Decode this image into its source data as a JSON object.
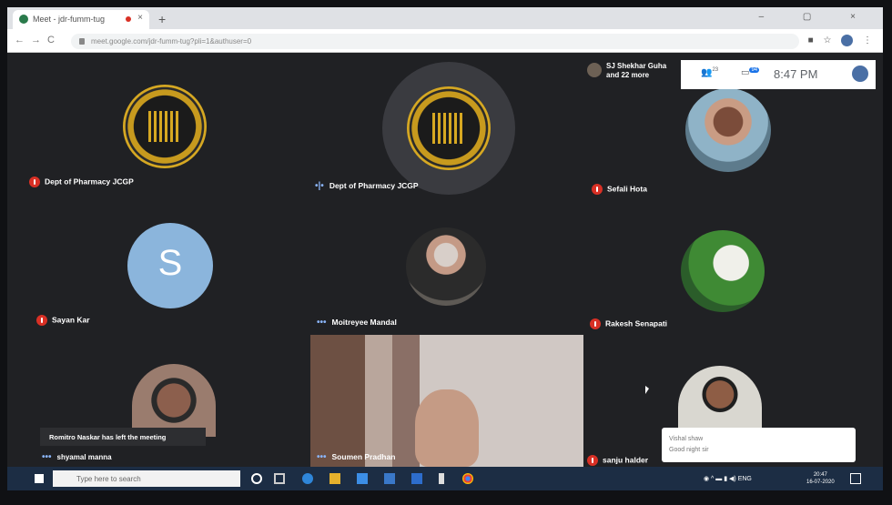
{
  "browser": {
    "tab_title": "Meet - jdr-fumm-tug",
    "tab_close": "×",
    "new_tab": "+",
    "window_controls": "– ▢ ×",
    "url": "meet.google.com/jdr-fumm-tug?pli=1&authuser=0",
    "nav_back": "←",
    "nav_forward": "→",
    "nav_reload": "C"
  },
  "meet": {
    "presenter": {
      "line1": "SJ Shekhar Guha",
      "line2": "and 22 more"
    },
    "clock": "8:47 PM",
    "participants_count": "23",
    "chat_count": "94",
    "tiles": [
      {
        "name": "Dept of Pharmacy JCGP"
      },
      {
        "name": "Dept of Pharmacy JCGP"
      },
      {
        "name": "Sefali Hota"
      },
      {
        "name": "Sayan Kar",
        "initial": "S"
      },
      {
        "name": "Moitreyee Mandal"
      },
      {
        "name": "Rakesh Senapati"
      },
      {
        "name": "shyamal manna"
      },
      {
        "name": "Soumen Pradhan"
      },
      {
        "name": "sanju halder"
      }
    ],
    "toast": "Romitro Naskar has left the meeting",
    "chat_popup": {
      "sender": "Vishal shaw",
      "message": "Good night sir"
    }
  },
  "taskbar": {
    "search_placeholder": "Type here to search",
    "tray_lang": "ENG",
    "time": "20:47",
    "date": "16-07-2020"
  },
  "colors": {
    "meet_bg": "#202124",
    "muted_red": "#d93025",
    "taskbar": "#1c2d44"
  }
}
